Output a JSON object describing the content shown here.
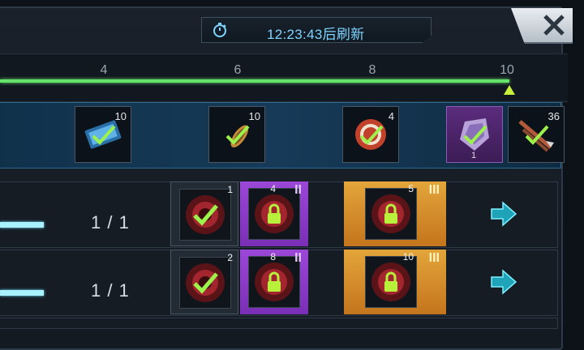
{
  "timer": {
    "text": "12:23:43后刷新",
    "icon": "stopwatch-icon"
  },
  "close": {
    "icon": "close-icon"
  },
  "milestones": {
    "ticks": [
      "4",
      "6",
      "8",
      "10"
    ],
    "progress_fraction": 1.0
  },
  "rewards": [
    {
      "name": "ticket",
      "count": "10",
      "claimed": true
    },
    {
      "name": "rocket",
      "count": "10",
      "claimed": true
    },
    {
      "name": "chip",
      "count": "4",
      "claimed": true
    },
    {
      "name": "crystal",
      "count": "",
      "sub": "1",
      "claimed": true
    },
    {
      "name": "arrows",
      "count": "36",
      "claimed": true
    }
  ],
  "tasks": [
    {
      "progress_text": "1 / 1",
      "progress_fraction": 1.0,
      "tiers": [
        {
          "num": "1",
          "tier": "",
          "state": "claimed"
        },
        {
          "num": "4",
          "tier": "II",
          "state": "locked"
        },
        {
          "num": "5",
          "tier": "III",
          "state": "locked"
        }
      ]
    },
    {
      "progress_text": "1 / 1",
      "progress_fraction": 1.0,
      "tiers": [
        {
          "num": "2",
          "tier": "",
          "state": "claimed"
        },
        {
          "num": "8",
          "tier": "II",
          "state": "locked"
        },
        {
          "num": "10",
          "tier": "III",
          "state": "locked"
        }
      ]
    }
  ],
  "colors": {
    "accent_cyan": "#7fd4ff",
    "progress_green": "#66e36a",
    "tier2_purple": "#9b47d8",
    "tier3_orange": "#e3a53a",
    "check_green": "#9cf24a"
  }
}
